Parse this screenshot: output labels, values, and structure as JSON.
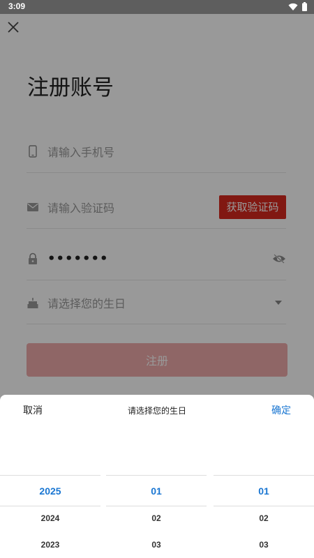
{
  "status_bar": {
    "time": "3:09",
    "icons": [
      "wifi-icon",
      "battery-icon"
    ]
  },
  "form": {
    "title": "注册账号",
    "phone_placeholder": "请输入手机号",
    "code_placeholder": "请输入验证码",
    "get_code_label": "获取验证码",
    "password_value": "•••••••",
    "birthday_placeholder": "请选择您的生日",
    "register_label": "注册"
  },
  "picker": {
    "cancel_label": "取消",
    "title": "请选择您的生日",
    "confirm_label": "确定",
    "years": [
      "2025",
      "2024",
      "2023"
    ],
    "months": [
      "01",
      "02",
      "03"
    ],
    "days": [
      "01",
      "02",
      "03"
    ]
  },
  "colors": {
    "accent_red": "#d8291f",
    "accent_blue": "#1976d2",
    "register_disabled": "#eeaaaa"
  }
}
